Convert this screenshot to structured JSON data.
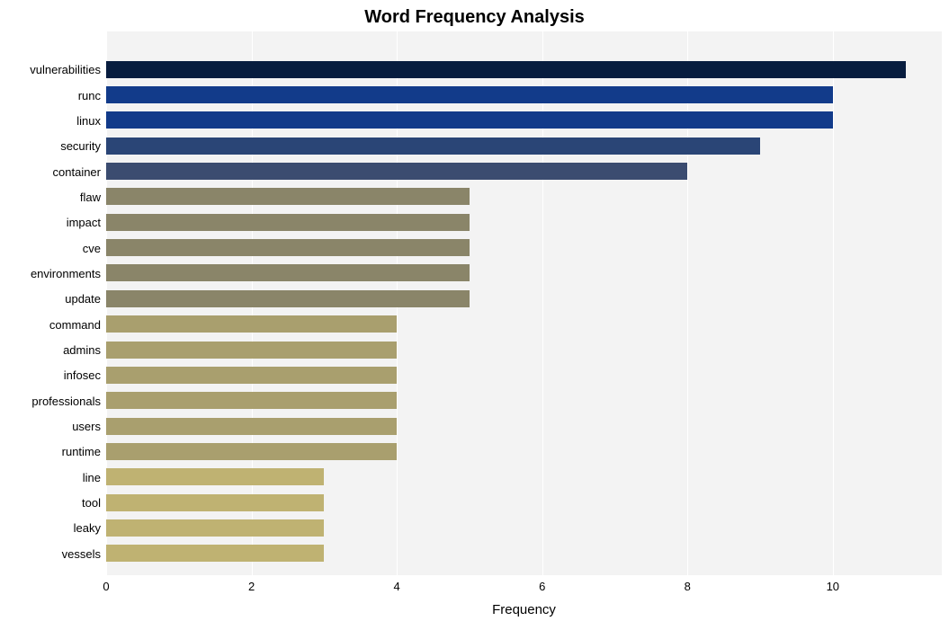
{
  "chart_data": {
    "type": "bar",
    "orientation": "horizontal",
    "title": "Word Frequency Analysis",
    "xlabel": "Frequency",
    "ylabel": "",
    "xlim": [
      0,
      11.5
    ],
    "xticks": [
      0,
      2,
      4,
      6,
      8,
      10
    ],
    "categories": [
      "vulnerabilities",
      "runc",
      "linux",
      "security",
      "container",
      "flaw",
      "impact",
      "cve",
      "environments",
      "update",
      "command",
      "admins",
      "infosec",
      "professionals",
      "users",
      "runtime",
      "line",
      "tool",
      "leaky",
      "vessels"
    ],
    "values": [
      11,
      10,
      10,
      9,
      8,
      5,
      5,
      5,
      5,
      5,
      4,
      4,
      4,
      4,
      4,
      4,
      3,
      3,
      3,
      3
    ],
    "colors": [
      "#081d3f",
      "#123b8a",
      "#123b8a",
      "#2a4576",
      "#3b4c70",
      "#8a8569",
      "#8a8569",
      "#8a8569",
      "#8a8569",
      "#8a8569",
      "#a99f6e",
      "#a99f6e",
      "#a99f6e",
      "#a99f6e",
      "#a99f6e",
      "#a99f6e",
      "#bfb272",
      "#bfb272",
      "#bfb272",
      "#bfb272"
    ]
  }
}
